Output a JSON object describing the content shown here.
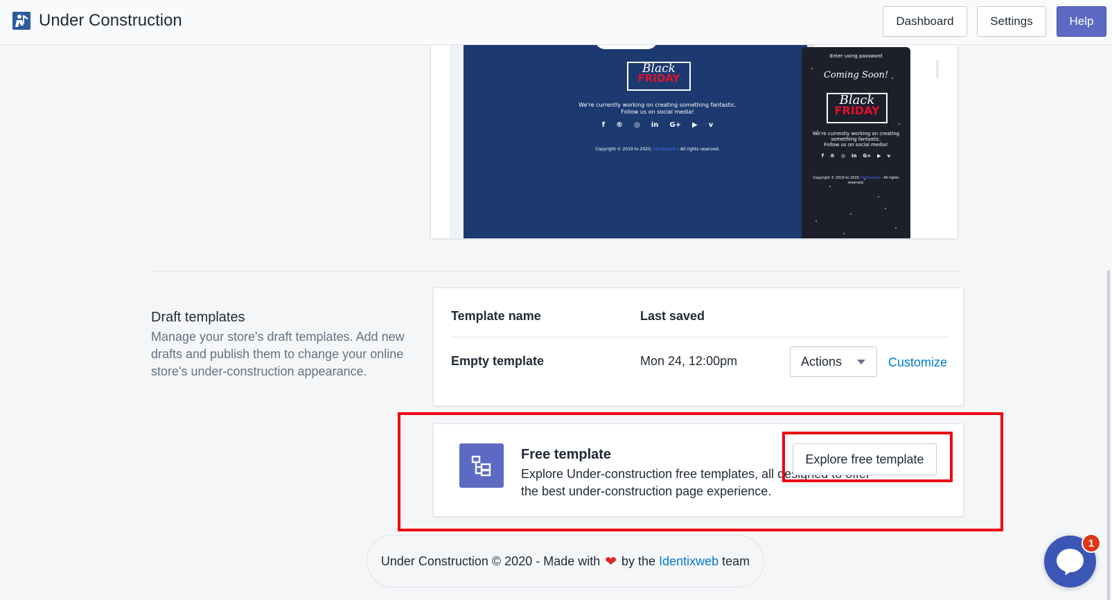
{
  "header": {
    "app_title": "Under Construction",
    "app_icon": "construction-worker-icon",
    "buttons": {
      "dashboard": "Dashboard",
      "settings": "Settings",
      "help": "Help"
    },
    "accent_color": "#5c6ac4"
  },
  "preview": {
    "desktop": {
      "heading_line1": "Black",
      "heading_line2": "FRIDAY",
      "message_line1": "We're currently working on creating something fantastic.",
      "message_line2": "Follow us on social media!",
      "social": [
        "f",
        "®",
        "◎",
        "in",
        "G+",
        "▶",
        "v"
      ],
      "copyright_prefix": "Copyright © 2019 to 2020,",
      "copyright_link": "Identixweb",
      "copyright_suffix": " - All rights reserved."
    },
    "mobile": {
      "password_prompt": "Enter using password",
      "coming_soon": "Coming Soon!",
      "heading_line1": "Black",
      "heading_line2": "FRIDAY",
      "message_line1": "We're currently working on creating something fantastic.",
      "message_line2": "Follow us on social media!",
      "social": [
        "f",
        "®",
        "◎",
        "in",
        "G+",
        "▶",
        "v"
      ],
      "copyright_prefix": "Copyright © 2019 to 2020,",
      "copyright_link": "Identixweb",
      "copyright_suffix": " - All rights reserved."
    },
    "background_color": "#1c3a6f"
  },
  "draft": {
    "title": "Draft templates",
    "description": "Manage your store's draft templates. Add new drafts and publish them to change your online store's under-construction appearance.",
    "columns": [
      "Template name",
      "Last saved"
    ],
    "rows": [
      {
        "name": "Empty template",
        "last_saved": "Mon 24, 12:00pm",
        "actions_label": "Actions",
        "customize_label": "Customize"
      }
    ]
  },
  "free_template": {
    "icon": "template-icon",
    "title": "Free template",
    "description": "Explore Under-construction free templates, all designed to offer the best under-construction page experience.",
    "button": "Explore free template"
  },
  "footer": {
    "prefix": "Under Construction © 2020 - Made with ",
    "heart": "❤",
    "middle": " by the ",
    "link": "Identixweb",
    "suffix": " team"
  },
  "chat": {
    "icon": "chat-icon",
    "badge_count": "1"
  }
}
